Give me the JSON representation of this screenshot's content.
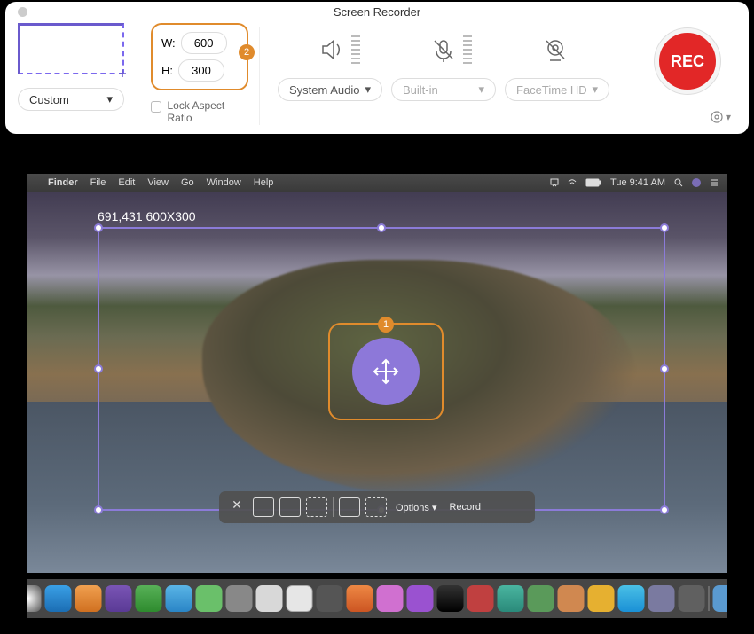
{
  "window": {
    "title": "Screen Recorder"
  },
  "region": {
    "mode_label": "Custom",
    "width_label": "W:",
    "height_label": "H:",
    "width_value": "600",
    "height_value": "300",
    "lock_label": "Lock Aspect Ratio",
    "wh_badge": "2"
  },
  "audio": {
    "sys_label": "System Audio",
    "mic_label": "Built-in",
    "cam_label": "FaceTime HD"
  },
  "rec": {
    "label": "REC"
  },
  "menubar": {
    "app": "Finder",
    "items": [
      "File",
      "Edit",
      "View",
      "Go",
      "Window",
      "Help"
    ],
    "time": "Tue 9:41 AM"
  },
  "selection": {
    "coord_label": "691,431 600X300",
    "move_badge": "1"
  },
  "capturebar": {
    "options": "Options",
    "record": "Record"
  }
}
